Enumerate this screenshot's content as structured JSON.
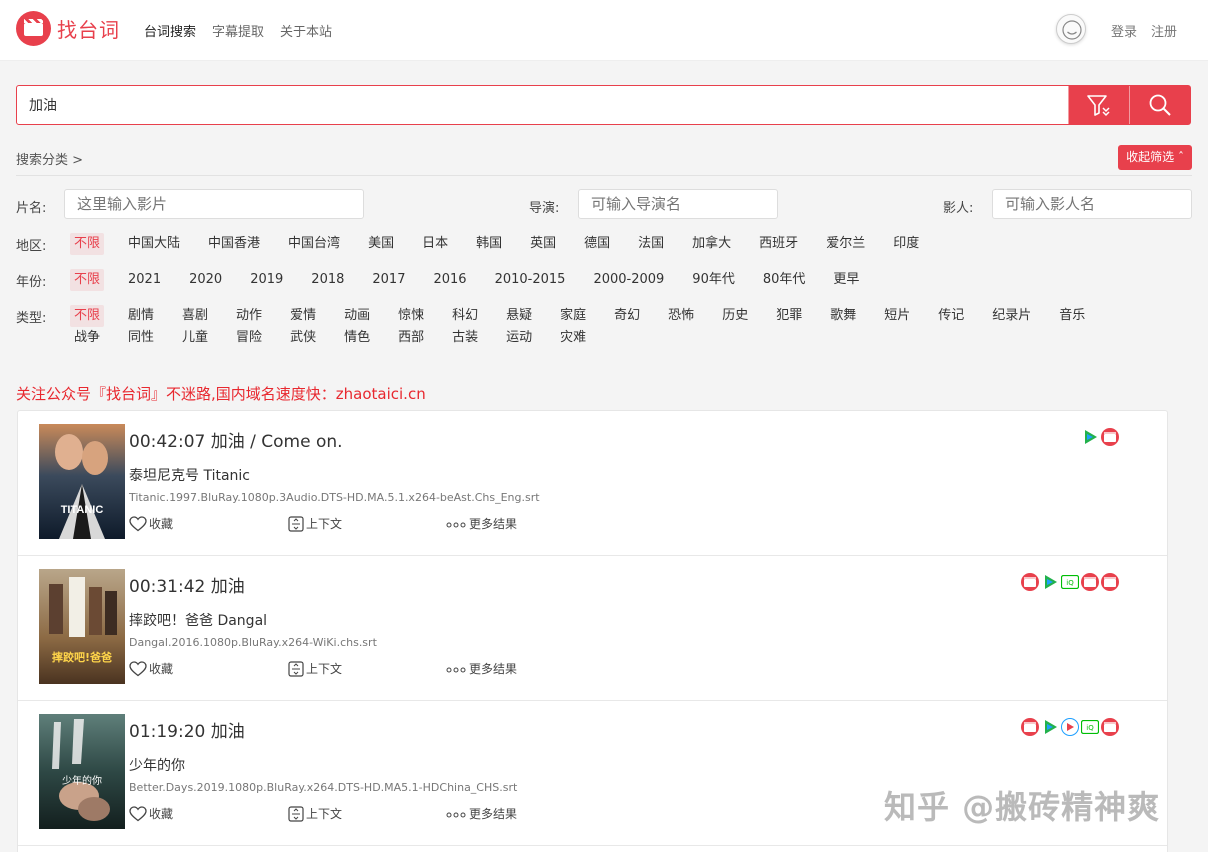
{
  "header": {
    "logo_text": "找台词",
    "nav": [
      "台词搜索",
      "字幕提取",
      "关于本站"
    ],
    "login": "登录",
    "register": "注册"
  },
  "search": {
    "value": "加油"
  },
  "filters": {
    "crumb": "搜索分类 >",
    "collapse": "收起筛选",
    "film_label": "片名:",
    "film_placeholder": "这里输入影片",
    "director_label": "导演:",
    "director_placeholder": "可输入导演名",
    "actor_label": "影人:",
    "actor_placeholder": "可输入影人名",
    "region_label": "地区:",
    "regions": [
      "不限",
      "中国大陆",
      "中国香港",
      "中国台湾",
      "美国",
      "日本",
      "韩国",
      "英国",
      "德国",
      "法国",
      "加拿大",
      "西班牙",
      "爱尔兰",
      "印度"
    ],
    "year_label": "年份:",
    "years": [
      "不限",
      "2021",
      "2020",
      "2019",
      "2018",
      "2017",
      "2016",
      "2010-2015",
      "2000-2009",
      "90年代",
      "80年代",
      "更早"
    ],
    "genre_label": "类型:",
    "genres_row1": [
      "不限",
      "剧情",
      "喜剧",
      "动作",
      "爱情",
      "动画",
      "惊悚",
      "科幻",
      "悬疑",
      "家庭",
      "奇幻",
      "恐怖",
      "历史",
      "犯罪",
      "歌舞",
      "短片",
      "传记",
      "纪录片",
      "音乐"
    ],
    "genres_row2": [
      "战争",
      "同性",
      "儿童",
      "冒险",
      "武侠",
      "情色",
      "西部",
      "古装",
      "运动",
      "灾难"
    ]
  },
  "notice": "关注公众号『找台词』不迷路,国内域名速度快：zhaotaici.cn",
  "results": [
    {
      "time": "00:42:07 加油 / Come on.",
      "title": "泰坦尼克号 Titanic",
      "file": "Titanic.1997.BluRay.1080p.3Audio.DTS-HD.MA.5.1.x264-beAst.Chs_Eng.srt",
      "poster_text": "TITANIC",
      "platforms": [
        "tencent-video",
        "video-site"
      ]
    },
    {
      "time": "00:31:42 加油",
      "title": "摔跤吧！爸爸 Dangal",
      "file": "Dangal.2016.1080p.BluRay.x264-WiKi.chs.srt",
      "poster_text": "摔跤吧!爸爸",
      "platforms": [
        "video-site",
        "tencent-video",
        "iqiyi",
        "video-site",
        "video-site"
      ]
    },
    {
      "time": "01:19:20 加油",
      "title": "少年的你",
      "file": "Better.Days.2019.1080p.BluRay.x264.DTS-HD.MA5.1-HDChina_CHS.srt",
      "poster_text": "少年的你",
      "platforms": [
        "video-site",
        "tencent-video",
        "youku",
        "iqiyi",
        "video-site"
      ]
    }
  ],
  "actions": {
    "favorite": "收藏",
    "context": "上下文",
    "more": "更多结果"
  },
  "watermark": "知乎 @搬砖精神爽",
  "colors": {
    "accent": "#e8404c",
    "tencent": "#22b14c",
    "iqiyi": "#00be06",
    "youku": "#1e9fff"
  }
}
